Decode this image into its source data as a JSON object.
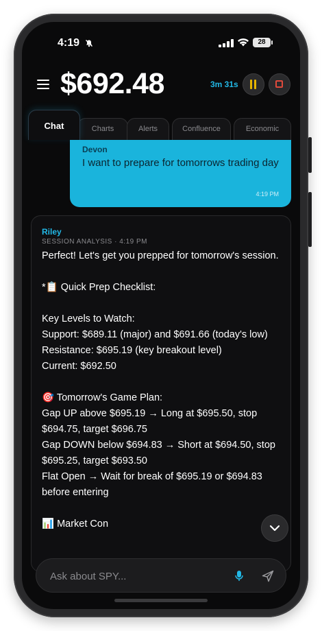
{
  "status_bar": {
    "time": "4:19",
    "battery": "28"
  },
  "header": {
    "price": "$692.48",
    "timer": "3m 31s"
  },
  "tabs": [
    {
      "label": "Chat",
      "active": true
    },
    {
      "label": "Charts"
    },
    {
      "label": "Alerts"
    },
    {
      "label": "Confluence"
    },
    {
      "label": "Economic"
    }
  ],
  "user_message": {
    "name": "Devon",
    "text": "I want to prepare for tomorrows trading day",
    "time": "4:19 PM"
  },
  "bot_message": {
    "name": "Riley",
    "meta": "SESSION ANALYSIS · 4:19 PM",
    "lines": [
      "Perfect! Let's get you prepped for tomorrow's session.",
      "",
      "*📋 Quick Prep Checklist:",
      "",
      "Key Levels to Watch:",
      "Support: $689.11 (major) and $691.66 (today's low)",
      "Resistance: $695.19 (key breakout level)",
      "Current: $692.50",
      "",
      "🎯 Tomorrow's Game Plan:",
      "Gap UP above $695.19 → Long at $695.50, stop $694.75, target $696.75",
      "Gap DOWN below $694.83 → Short at $694.50, stop $695.25, target $693.50",
      "Flat Open → Wait for break of $695.19 or $694.83 before entering",
      "",
      "📊 Market Con"
    ]
  },
  "input": {
    "placeholder": "Ask about SPY..."
  },
  "colors": {
    "accent": "#22b8e6",
    "user_bubble": "#1ab4dc",
    "pause": "#e6b400",
    "stop": "#e04a3c",
    "background": "#0a0a0b"
  }
}
